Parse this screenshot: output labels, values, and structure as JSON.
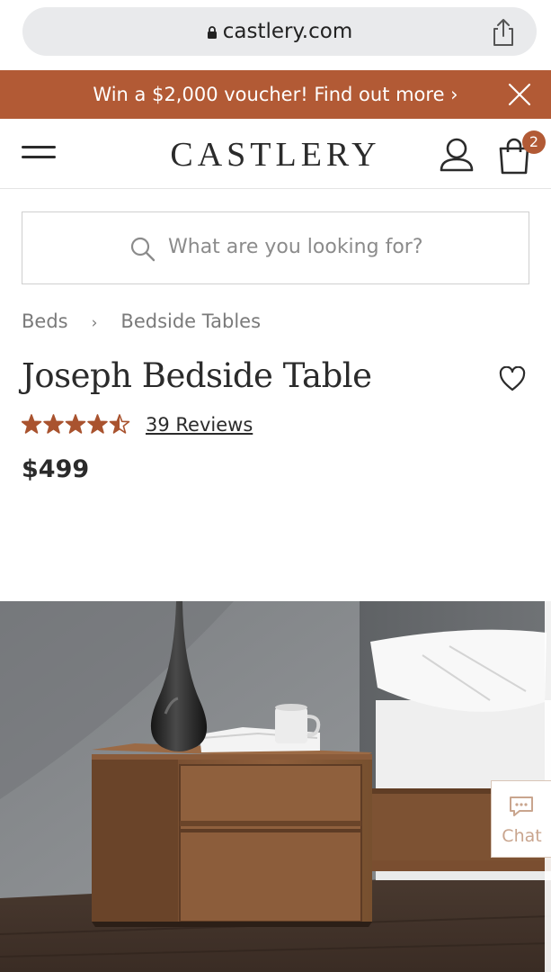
{
  "browser": {
    "url": "castlery.com"
  },
  "promo": {
    "text": "Win a $2,000 voucher! Find out more ›"
  },
  "header": {
    "logo": "CASTLERY",
    "cart_count": "2"
  },
  "search": {
    "placeholder": "What are you looking for?"
  },
  "breadcrumb": {
    "items": [
      "Beds",
      "Bedside Tables"
    ],
    "separator": "›"
  },
  "product": {
    "title": "Joseph Bedside Table",
    "rating": 4.5,
    "reviews_label": "39 Reviews",
    "price": "$499"
  },
  "chat": {
    "label": "Chat"
  },
  "colors": {
    "accent": "#b25a35",
    "text": "#2b2b2b",
    "star": "#a9532f"
  },
  "icons": [
    "lock-icon",
    "share-icon",
    "close-icon",
    "menu-icon",
    "user-icon",
    "shopping-bag-icon",
    "search-icon",
    "heart-icon",
    "star-icon",
    "chat-icon"
  ]
}
